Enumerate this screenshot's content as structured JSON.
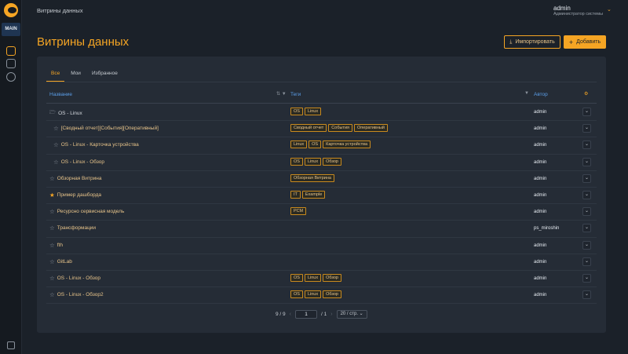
{
  "sidebar": {
    "main_label": "MAIN"
  },
  "header": {
    "breadcrumb": "Витрины данных",
    "user_name": "admin",
    "user_role": "Администратор системы"
  },
  "page": {
    "title": "Витрины данных",
    "import_label": "Импортировать",
    "add_label": "Добавить"
  },
  "tabs": [
    "Все",
    "Мои",
    "Избранное"
  ],
  "columns": {
    "name": "Название",
    "tags": "Теги",
    "author": "Автор"
  },
  "rows": [
    {
      "name": "OS - Linux",
      "tags": [
        "OS",
        "Linux"
      ],
      "author": "admin"
    },
    {
      "name": "[Сводный отчет][События][Оперативный]",
      "tags": [
        "Сводный отчет",
        "События",
        "Оперативный"
      ],
      "author": "admin"
    },
    {
      "name": "OS - Linux - Карточка устройства",
      "tags": [
        "Linux",
        "OS",
        "Карточка устройства"
      ],
      "author": "admin"
    },
    {
      "name": "OS - Linux - Обзор",
      "tags": [
        "OS",
        "Linux",
        "Обзор"
      ],
      "author": "admin"
    },
    {
      "name": "Обзорная Витрина",
      "tags": [
        "Обзорная Витрина"
      ],
      "author": "admin"
    },
    {
      "name": "Пример дашборда",
      "tags": [
        "IT",
        "Example"
      ],
      "author": "admin"
    },
    {
      "name": "Ресурсно сервисная модель",
      "tags": [
        "РСМ"
      ],
      "author": "admin"
    },
    {
      "name": "Трансформации",
      "tags": [],
      "author": "ps_miroshin"
    },
    {
      "name": "fth",
      "tags": [],
      "author": "admin"
    },
    {
      "name": "GitLab",
      "tags": [],
      "author": "admin"
    },
    {
      "name": "OS - Linux - Обзор",
      "tags": [
        "OS",
        "Linux",
        "Обзор"
      ],
      "author": "admin"
    },
    {
      "name": "OS - Linux - Обзор2",
      "tags": [
        "OS",
        "Linux",
        "Обзор"
      ],
      "author": "admin"
    }
  ],
  "pagination": {
    "count": "9 / 9",
    "page": "1",
    "total": "/ 1",
    "size": "20 / стр."
  },
  "colors": {
    "accent": "#f5a524",
    "link": "#5b9ee8",
    "background": "#1b2129",
    "card": "#252c36"
  }
}
